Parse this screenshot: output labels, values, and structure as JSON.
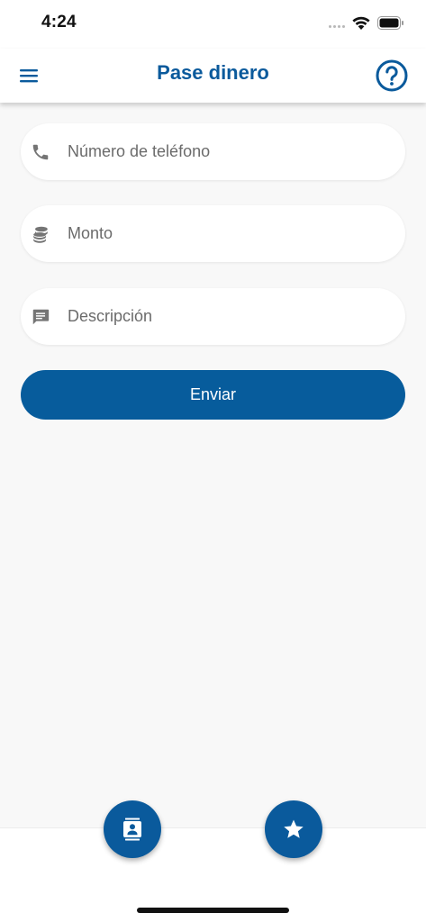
{
  "status_bar": {
    "time": "4:24"
  },
  "app_bar": {
    "title": "Pase dinero",
    "menu_icon": "hamburger-menu-icon",
    "help_icon": "help-circle-icon"
  },
  "form": {
    "phone": {
      "icon": "phone-icon",
      "placeholder": "Número de teléfono",
      "value": ""
    },
    "amount": {
      "icon": "coins-icon",
      "placeholder": "Monto",
      "value": ""
    },
    "description": {
      "icon": "message-icon",
      "placeholder": "Descripción",
      "value": ""
    },
    "submit_label": "Enviar"
  },
  "bottom_actions": {
    "contacts_icon": "contacts-icon",
    "favorites_icon": "star-icon"
  },
  "colors": {
    "primary": "#0a5a9c",
    "background": "#f8f8f8",
    "field_background": "#ffffff",
    "icon_gray": "#757575"
  }
}
